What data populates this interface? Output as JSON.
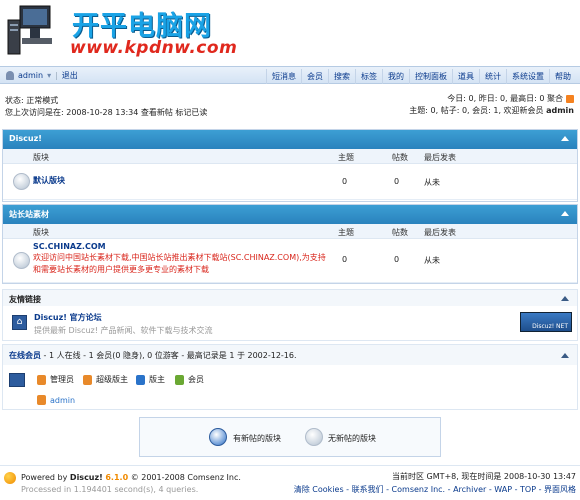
{
  "logo": {
    "title": "开平电脑网",
    "url": "www.kpdnw.com"
  },
  "nav": {
    "username": "admin",
    "logout": "退出",
    "menu": [
      "短消息",
      "会员",
      "搜索",
      "标签",
      "我的",
      "控制面板",
      "道具",
      "统计",
      "系统设置",
      "帮助"
    ]
  },
  "status": {
    "line1": "状态: 正常模式",
    "line2": "您上次访问是在: 2008-10-28 13:34 查看新帖 标记已读"
  },
  "stats": {
    "line1": "今日: 0, 昨日: 0, 最高日: 0   聚合",
    "line2_prefix": "主题: 0, 帖子: 0, 会员: 1, 欢迎新会员",
    "line2_user": "admin"
  },
  "sections": [
    {
      "title": "Discuz!",
      "headers": {
        "forum": "版块",
        "topics": "主题",
        "posts": "帖数",
        "last": "最后发表"
      },
      "forum": {
        "name": "默认版块",
        "topics": "0",
        "posts": "0",
        "last": "从未"
      }
    },
    {
      "title": "站长站素材",
      "headers": {
        "forum": "版块",
        "topics": "主题",
        "posts": "帖数",
        "last": "最后发表"
      },
      "forum": {
        "name": "SC.CHINAZ.COM",
        "desc": "欢迎访问中国站长素材下载,中国站长站推出素材下载站(SC.CHINAZ.COM),为支持和需要站长素材的用户提供更多更专业的素材下载",
        "topics": "0",
        "posts": "0",
        "last": "从未"
      }
    }
  ],
  "links": {
    "title": "友情链接",
    "name": "Discuz! 官方论坛",
    "desc": "提供最新 Discuz! 产品新闻、软件下载与技术交流",
    "badge": "Discuz! NET"
  },
  "online": {
    "title": "在线会员",
    "summary": " - 1 人在线 - 1 会员(0 隐身), 0 位游客 - 最高记录是 1 于 2002-12-16.",
    "legend": [
      "管理员",
      "超级版主",
      "版主",
      "会员"
    ],
    "member": "admin",
    "legend_colors": [
      "#e8892a",
      "#e8892a",
      "#2a73c9",
      "#6aa833"
    ]
  },
  "legend_box": {
    "new": "有新帖的版块",
    "nonew": "无新帖的版块"
  },
  "footer": {
    "powered_prefix": "Powered by",
    "product": "Discuz!",
    "version": "6.1.0",
    "copyright": "© 2001-2008 Comsenz Inc.",
    "processed": "Processed in 1.194401 second(s), 4 queries.",
    "time": "当前时区 GMT+8, 现在时间是 2008-10-30 13:47",
    "links": "清除 Cookies - 联系我们 - Comsenz Inc. - Archiver - WAP - TOP - 界面风格"
  }
}
